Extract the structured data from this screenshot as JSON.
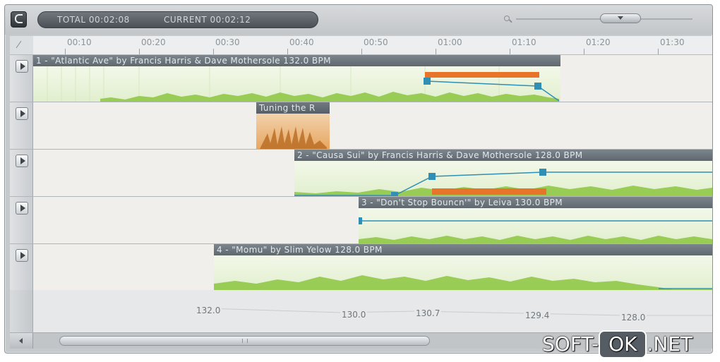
{
  "header": {
    "logo_letter": "C",
    "total_label": "TOTAL 00:02:08",
    "current_label": "CURRENT 00:02:12"
  },
  "zoom": {
    "level_fraction": 0.55
  },
  "ruler": {
    "tick_labels": [
      "00:10",
      "00:20",
      "00:30",
      "00:40",
      "00:50",
      "01:00",
      "01:10",
      "01:20",
      "01:30"
    ]
  },
  "tracks": [
    {
      "clip_title": "1 - \"Atlantic Ave\" by Francis Harris & Dave Mothersole 132.0 BPM"
    },
    {
      "clip_title": "Tuning the R"
    },
    {
      "clip_title": "2 - \"Causa Sui\" by Francis Harris & Dave Mothersole 128.0 BPM"
    },
    {
      "clip_title": "3 - \"Don't Stop Bouncn'\" by Leiva 130.0 BPM"
    },
    {
      "clip_title": "4 - \"Momu\" by Slim Yelow 128.0 BPM"
    }
  ],
  "tempo_labels": [
    "132.0",
    "130.0",
    "130.7",
    "129.4",
    "128.0"
  ],
  "scrollbar": {
    "position_fraction": 0.06
  },
  "watermark": {
    "left": "SOFT-",
    "middle": "OK",
    "right": ".NET"
  },
  "colors": {
    "waveform": "#8cc63f",
    "crossfade_bar": "#e8742a",
    "automation_node": "#2f8fb5",
    "clip_title_bar": "#667077"
  }
}
